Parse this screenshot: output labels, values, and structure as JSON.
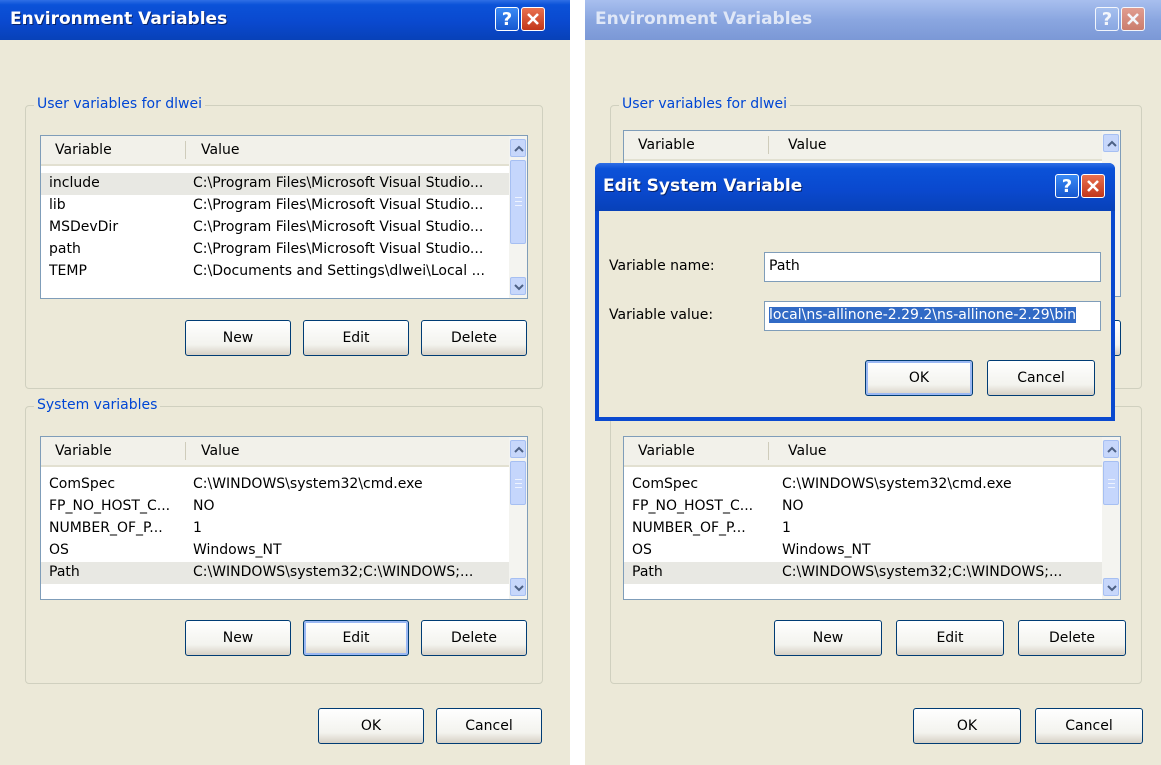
{
  "left": {
    "title": "Environment Variables",
    "user_group": "User variables for dlwei",
    "system_group": "System variables",
    "user_columns": [
      "Variable",
      "Value"
    ],
    "user_rows": [
      {
        "name": "include",
        "value": "C:\\Program Files\\Microsoft Visual Studio..."
      },
      {
        "name": "lib",
        "value": "C:\\Program Files\\Microsoft Visual Studio..."
      },
      {
        "name": "MSDevDir",
        "value": "C:\\Program Files\\Microsoft Visual Studio..."
      },
      {
        "name": "path",
        "value": "C:\\Program Files\\Microsoft Visual Studio..."
      },
      {
        "name": "TEMP",
        "value": "C:\\Documents and Settings\\dlwei\\Local ..."
      }
    ],
    "system_columns": [
      "Variable",
      "Value"
    ],
    "system_rows": [
      {
        "name": "ComSpec",
        "value": "C:\\WINDOWS\\system32\\cmd.exe"
      },
      {
        "name": "FP_NO_HOST_C...",
        "value": "NO"
      },
      {
        "name": "NUMBER_OF_P...",
        "value": "1"
      },
      {
        "name": "OS",
        "value": "Windows_NT"
      },
      {
        "name": "Path",
        "value": "C:\\WINDOWS\\system32;C:\\WINDOWS;..."
      }
    ],
    "user_buttons": [
      "New",
      "Edit",
      "Delete"
    ],
    "system_buttons": [
      "New",
      "Edit",
      "Delete"
    ],
    "ok": "OK",
    "cancel": "Cancel"
  },
  "right": {
    "title": "Environment Variables",
    "user_group": "User variables for dlwei",
    "user_columns": [
      "Variable",
      "Value"
    ],
    "system_columns": [
      "Variable",
      "Value"
    ],
    "system_rows": [
      {
        "name": "ComSpec",
        "value": "C:\\WINDOWS\\system32\\cmd.exe"
      },
      {
        "name": "FP_NO_HOST_C...",
        "value": "NO"
      },
      {
        "name": "NUMBER_OF_P...",
        "value": "1"
      },
      {
        "name": "OS",
        "value": "Windows_NT"
      },
      {
        "name": "Path",
        "value": "C:\\WINDOWS\\system32;C:\\WINDOWS;..."
      }
    ],
    "system_buttons": [
      "New",
      "Edit",
      "Delete"
    ],
    "ok": "OK",
    "cancel": "Cancel"
  },
  "edit_dialog": {
    "title": "Edit System Variable",
    "name_label": "Variable name:",
    "name_value": "Path",
    "value_label": "Variable value:",
    "value_value": "local\\ns-allinone-2.29.2\\ns-allinone-2.29\\bin",
    "ok": "OK",
    "cancel": "Cancel"
  },
  "icons": {
    "help": "?",
    "close": "close-x-icon"
  },
  "colors": {
    "titlebar": "#0a49cf",
    "group_label": "#0046d5",
    "dialog_bg": "#ece9d8",
    "selection": "#316ac5"
  }
}
